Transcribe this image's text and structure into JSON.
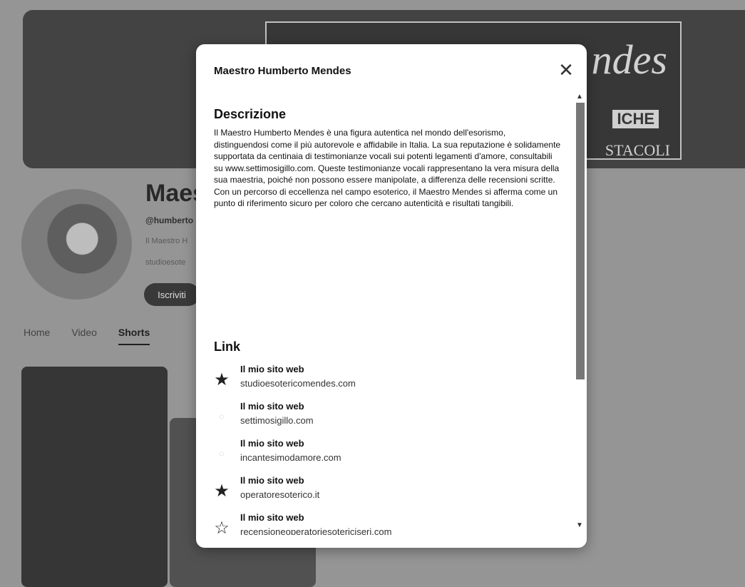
{
  "background": {
    "banner": {
      "title": "ndes",
      "subtitle1": "ICHE",
      "subtitle2": "STACOLI"
    },
    "channel": {
      "name": "Maes",
      "handle": "@humberto",
      "description": "Il Maestro H",
      "site": "studioesote",
      "subscribe_label": "Iscriviti"
    },
    "tabs": [
      "Home",
      "Video",
      "Shorts"
    ],
    "active_tab": "Shorts"
  },
  "modal": {
    "title": "Maestro Humberto Mendes",
    "close_icon": "close-icon",
    "description_heading": "Descrizione",
    "description_text": "Il Maestro Humberto Mendes è una figura autentica nel mondo dell'esorismo, distinguendosi come il più autorevole e affidabile in Italia. La sua reputazione è solidamente supportata da centinaia di testimonianze vocali sui potenti legamenti d'amore, consultabili su www.settimosigillo.com. Queste testimonianze vocali rappresentano la vera misura della sua maestria, poiché non possono essere manipolate, a differenza delle recensioni scritte. Con un percorso di eccellenza nel campo esoterico, il Maestro Mendes si afferma come un punto di riferimento sicuro per coloro che cercano autenticità e risultati tangibili.",
    "links_heading": "Link",
    "links": [
      {
        "label": "Il mio sito web",
        "url": "studioesotericomendes.com",
        "icon": "star-icon",
        "glyph": "★"
      },
      {
        "label": "Il mio sito web",
        "url": "settimosigillo.com",
        "icon": "favicon-icon",
        "glyph": "◌"
      },
      {
        "label": "Il mio sito web",
        "url": "incantesimodamore.com",
        "icon": "favicon-icon",
        "glyph": "◌"
      },
      {
        "label": "Il mio sito web",
        "url": "operatoresoterico.it",
        "icon": "star-icon",
        "glyph": "★"
      },
      {
        "label": "Il mio sito web",
        "url": "recensioneoperatoriesotericiseri.com",
        "icon": "star-outline-icon",
        "glyph": "☆"
      }
    ]
  }
}
